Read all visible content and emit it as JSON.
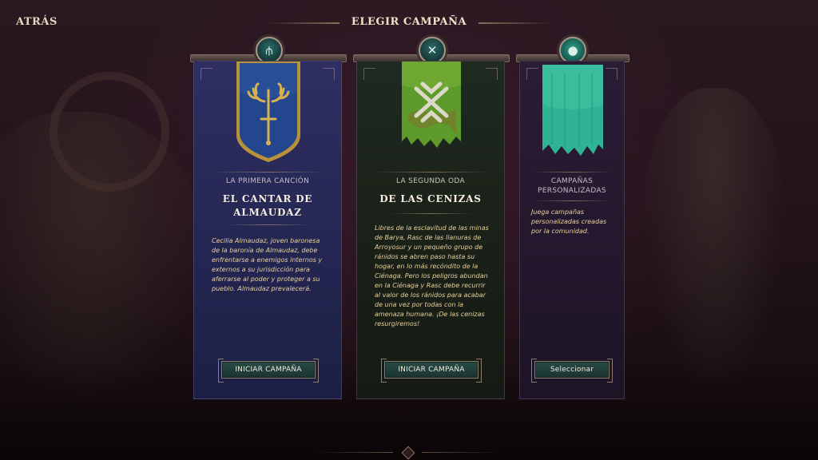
{
  "header": {
    "back_label": "ATRÁS",
    "title": "ELEGIR CAMPAÑA"
  },
  "campaigns": [
    {
      "subtitle": "LA PRIMERA CANCIÓN",
      "name_line1": "EL CANTAR DE",
      "name_line2": "ALMAUDAZ",
      "description": "Cecilia Almaudaz, joven baronesa de la baronía de Almaudaz, debe enfrentarse a enemigos internos y externos a su jurisdicción para aferrarse al poder y proteger a su pueblo. Almaudaz prevalecerá.",
      "button_label": "INICIAR CAMPAÑA",
      "banner_color": "#23468f",
      "emblem_icon": "antlered-sword-icon"
    },
    {
      "subtitle": "LA SEGUNDA ODA",
      "name_line1": "DE LAS CENIZAS",
      "description": "Libres de la esclavitud de las minas de Barya, Rasc de las llanuras de Arroyosur y un pequeño grupo de ránidos se abren paso hasta su hogar, en lo más recóndito de la Ciénaga. Pero los peligros abundan en la Ciénaga y Rasc debe recurrir al valor de los ránidos para acabar de una vez por todas con la amenaza humana. ¡De las cenizas resurgiremos!",
      "button_label": "INICIAR CAMPAÑA",
      "banner_color": "#5c9b2c",
      "emblem_icon": "rune-cross-icon"
    },
    {
      "subtitle_line1": "CAMPAÑAS",
      "subtitle_line2": "PERSONALIZADAS",
      "description": "Juega campañas personalizadas creadas por la comunidad.",
      "button_label": "Seleccionar",
      "banner_color": "#2fb394",
      "emblem_icon": "blank-banner-icon"
    }
  ]
}
